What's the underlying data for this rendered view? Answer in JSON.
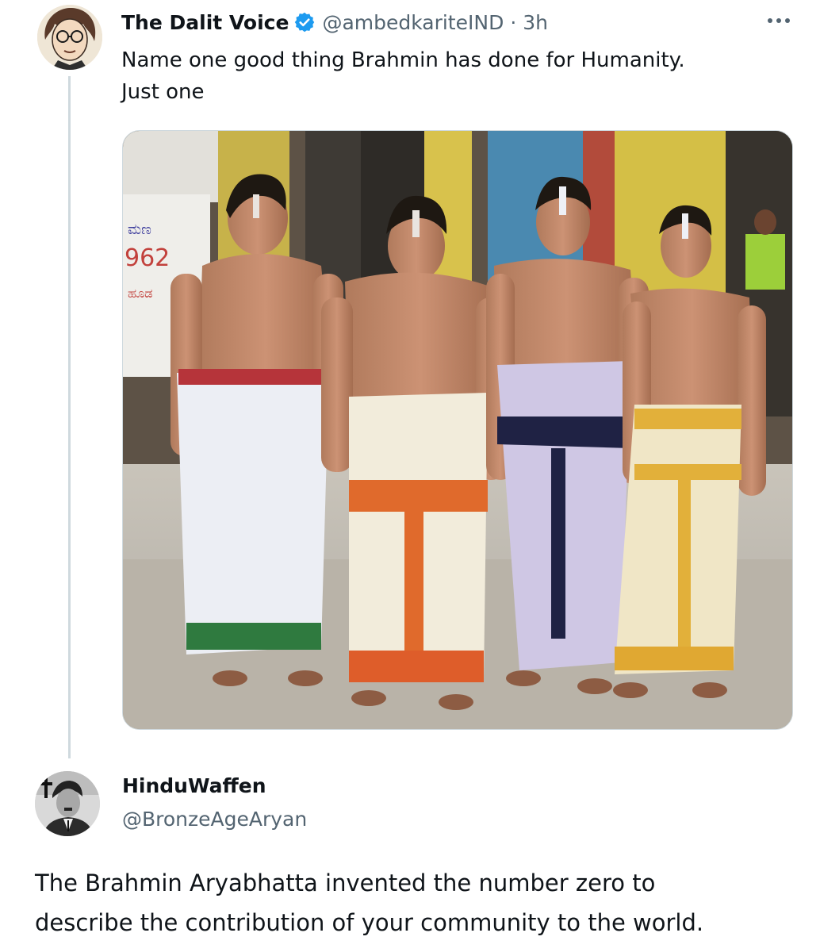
{
  "tweet": {
    "author_name": "The Dalit Voice",
    "author_handle": "@ambedkariteIND",
    "separator": "·",
    "time": "3h",
    "text_line1": "Name one good thing Brahmin has done for Humanity.",
    "text_line2": "Just one",
    "more_icon": "ellipsis-icon",
    "verified_icon": "verified-badge-icon",
    "media": {
      "sign_text": "962",
      "sign_script_line": "ಮಣ",
      "sign_script_line2": "ಹೂಡ"
    }
  },
  "reply": {
    "author_name": "HinduWaffen",
    "author_handle": "@BronzeAgeAryan",
    "text_line1": "The Brahmin Aryabhatta invented the number zero to",
    "text_line2": "describe the contribution of your community to the world."
  },
  "colors": {
    "text_primary": "#0f1419",
    "text_secondary": "#536471",
    "verified_blue": "#1d9bf0",
    "thread_line": "#cfd9de"
  }
}
